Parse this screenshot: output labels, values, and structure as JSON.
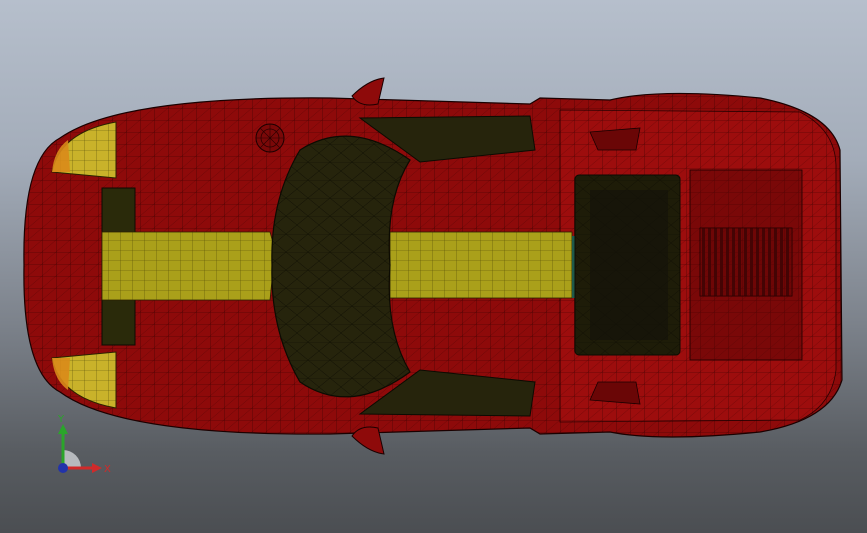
{
  "viewport": {
    "background_top": "#b6bfcc",
    "background_bottom": "#4b4e52"
  },
  "model": {
    "name": "car-body-mesh",
    "body_color": "#8e0a0a",
    "stripe_color": "#aaa01a",
    "glass_color": "#26240c",
    "mesh_line_color": "#1a0000",
    "view": "top"
  },
  "triad": {
    "y_label": "Y",
    "x_label": "X",
    "y_color": "#2aa52a",
    "x_color": "#d02a2a",
    "origin_color": "#2233aa"
  }
}
